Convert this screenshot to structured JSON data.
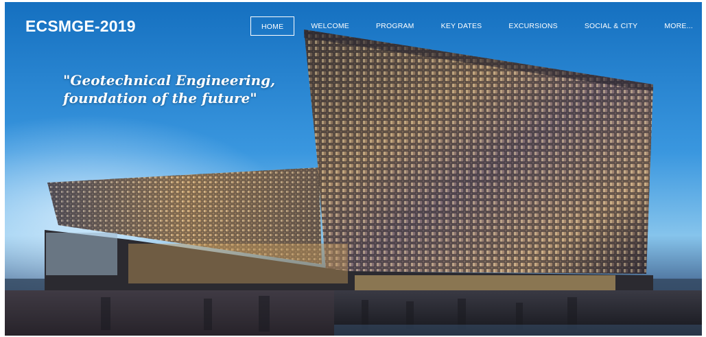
{
  "site": {
    "title": "ECSMGE-2019"
  },
  "nav": {
    "items": [
      {
        "label": "HOME",
        "active": true
      },
      {
        "label": "WELCOME",
        "active": false
      },
      {
        "label": "PROGRAM",
        "active": false
      },
      {
        "label": "KEY DATES",
        "active": false
      },
      {
        "label": "EXCURSIONS",
        "active": false
      },
      {
        "label": "SOCIAL & CITY",
        "active": false
      },
      {
        "label": "MORE...",
        "active": false
      }
    ]
  },
  "hero": {
    "tagline_line1": "\"Geotechnical Engineering,",
    "tagline_line2": "foundation of the future\""
  },
  "colors": {
    "sky": "#2a8ad8",
    "text": "#ffffff",
    "glass_warm": "#d8b77a",
    "ground": "#1d2230"
  },
  "icons": {
    "hero_image": "concert-hall-glass-facade-image"
  }
}
